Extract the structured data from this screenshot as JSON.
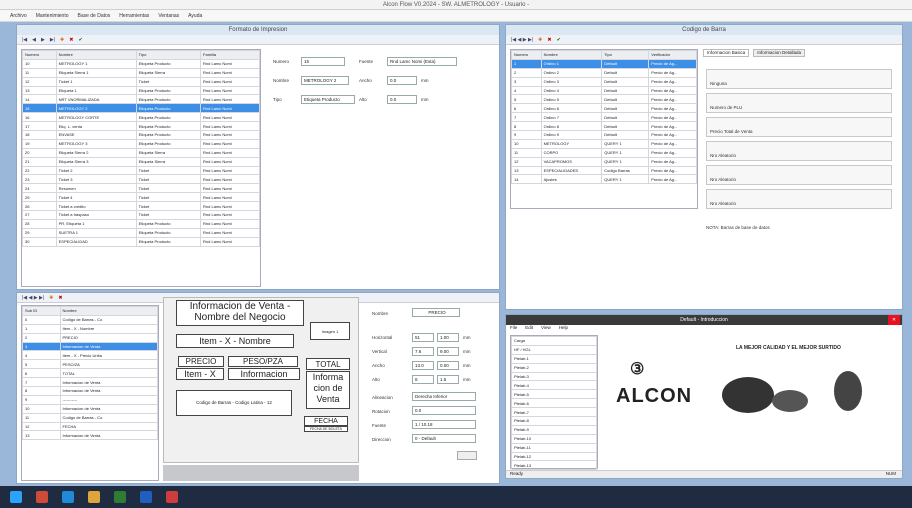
{
  "app": {
    "title": "Alcon Flow V0.2024 - SW. ALMETROLOGY - Usuario -",
    "menu": [
      "Archivo",
      "Mantenimiento",
      "Base de Datos",
      "Herramientas",
      "Ventanas",
      "Ayuda"
    ]
  },
  "formats_window": {
    "title": "Formato de Impresion",
    "grid_headers": [
      "Numero",
      "Nombre",
      "Tipo",
      "Familia"
    ],
    "rows": [
      [
        "10",
        "METROLOGY 1",
        "Etiqueta Producto",
        "Rnd Lamc Nomi"
      ],
      [
        "11",
        "Etiqueta Sierra 1",
        "Etiqueta Sierra",
        "Rnd Lamc Nomi"
      ],
      [
        "12",
        "Ticket 1",
        "Ticket",
        "Rnd Lamc Nomi"
      ],
      [
        "13",
        "Etiqueta 1",
        "Etiqueta Producto",
        "Rnd Lamc Nomi"
      ],
      [
        "14",
        "NRT VNORMALIZADA",
        "Etiqueta Producto",
        "Rnd Lamc Nomi"
      ],
      [
        "15",
        "METROLOGY 2",
        "Etiqueta Producto",
        "Rnd Lamc Nomi"
      ],
      [
        "16",
        "METROLOGY CORTE",
        "Etiqueta Producto",
        "Rnd Lamc Nomi"
      ],
      [
        "17",
        "Etiq. L. venta",
        "Etiqueta Producto",
        "Rnd Lamc Nomi"
      ],
      [
        "18",
        "ENVASE",
        "Etiqueta Producto",
        "Rnd Lamc Nomi"
      ],
      [
        "19",
        "METROLOGY 3",
        "Etiqueta Producto",
        "Rnd Lamc Nomi"
      ],
      [
        "20",
        "Etiqueta Sierra 2",
        "Etiqueta Sierra",
        "Rnd Lamc Nomi"
      ],
      [
        "21",
        "Etiqueta Sierra 3",
        "Etiqueta Sierra",
        "Rnd Lamc Nomi"
      ],
      [
        "22",
        "Ticket 2",
        "Ticket",
        "Rnd Lamc Nomi"
      ],
      [
        "23",
        "Ticket 3",
        "Ticket",
        "Rnd Lamc Nomi"
      ],
      [
        "24",
        "Resumen",
        "Ticket",
        "Rnd Lamc Nomi"
      ],
      [
        "25",
        "Ticket 4",
        "Ticket",
        "Rnd Lamc Nomi"
      ],
      [
        "26",
        "Ticket a credito",
        "Ticket",
        "Rnd Lamc Nomi"
      ],
      [
        "27",
        "Ticket a traspaso",
        "Ticket",
        "Rnd Lamc Nomi"
      ],
      [
        "28",
        "PR. Etiqueta 1",
        "Etiqueta Producto",
        "Rnd Lamc Nomi"
      ],
      [
        "29",
        "SUETRA 1",
        "Etiqueta Producto",
        "Rnd Lamc Nomi"
      ],
      [
        "30",
        "ESPECIALIDAD",
        "Etiqueta Producto",
        "Rnd Lamc Nomi"
      ]
    ],
    "selected_index": 5,
    "form": {
      "numero_label": "Numero",
      "numero": "15",
      "nombre_label": "Nombre",
      "nombre": "METROLOGY 2",
      "tipo_label": "Tipo",
      "tipo": "Etiqueta Producto",
      "fuente_label": "Fuente",
      "fuente": "Rnd Lamc Nomi (Esta)",
      "ancho_label": "Ancho",
      "ancho": "0.0",
      "alto_label": "Alto",
      "alto": "0.0",
      "mm": "mm"
    }
  },
  "sub_grid": {
    "headers": [
      "Sub ID",
      "Nombre"
    ],
    "rows": [
      [
        "0",
        "Codigo de Barras - Co"
      ],
      [
        "1",
        "Item - X - Nombre"
      ],
      [
        "2",
        "PRECIO"
      ],
      [
        "3",
        "Informacion de Venta"
      ],
      [
        "4",
        "Item - X - Precio Unita"
      ],
      [
        "5",
        "PESO/ZA"
      ],
      [
        "6",
        "TOTAL"
      ],
      [
        "7",
        "Informacion de Venta"
      ],
      [
        "8",
        "Informacion de Venta"
      ],
      [
        "9",
        "-----------"
      ],
      [
        "10",
        "Informacion de Venta"
      ],
      [
        "11",
        "Codigo de Barras - Co"
      ],
      [
        "12",
        "FECHA"
      ],
      [
        "13",
        "Informacion de Venta"
      ]
    ],
    "selected_index": 3
  },
  "ticket": {
    "info_venta": "Informacion de Venta -",
    "nombre_negocio": "Nombre del Negocio",
    "item_nombre": "Item - X - Nombre",
    "precio": "PRECIO",
    "peso": "PESO/PZA",
    "item": "Item - X",
    "informacion": "Informacion",
    "total": "TOTAL",
    "info_venta_vertical": "Informa cion de Venta",
    "barcode": "Codigo de Barras - Codigo Latina - 12",
    "fecha": "FECHA",
    "fecha_sub": "FECHA DE BOLETA",
    "imagen": "Imagen 1"
  },
  "properties": {
    "nombre_label": "Nombre",
    "nombre": "PRECIO",
    "rows": [
      [
        "Horizontal",
        "51",
        "1.00",
        "mm"
      ],
      [
        "Vertical",
        "7.6",
        "9.00",
        "mm"
      ],
      [
        "Ancho",
        "13.0",
        "0.00",
        "mm"
      ],
      [
        "Alto",
        "8",
        "1.5",
        "mm"
      ]
    ],
    "alineacion_label": "Alineacion",
    "alineacion": "Derecha Inferior",
    "rotacion_label": "Rotacion",
    "rotacion": "0.0",
    "fuente_label": "Fuente",
    "fuente": "1 / 10.18",
    "direccion_label": "Direccion",
    "direccion": "0 - Default"
  },
  "barcode_window": {
    "title": "Codigo de Barra",
    "headers": [
      "Numero",
      "Nombre",
      "Tipo",
      "Verificador"
    ],
    "rows": [
      [
        "1",
        "Ordino 1",
        "Default",
        "Precio de Ag..."
      ],
      [
        "2",
        "Ordino 2",
        "Default",
        "Precio de Ag..."
      ],
      [
        "3",
        "Ordino 3",
        "Default",
        "Precio de Ag..."
      ],
      [
        "4",
        "Ordino 4",
        "Default",
        "Precio de Ag..."
      ],
      [
        "5",
        "Ordino 5",
        "Default",
        "Precio de Ag..."
      ],
      [
        "6",
        "Ordino 6",
        "Default",
        "Precio de Ag..."
      ],
      [
        "7",
        "Ordino 7",
        "Default",
        "Precio de Ag..."
      ],
      [
        "8",
        "Ordino 8",
        "Default",
        "Precio de Ag..."
      ],
      [
        "9",
        "Ordino 9",
        "Default",
        "Precio de Ag..."
      ],
      [
        "10",
        "METROLOGY",
        "QUERY 1",
        "Precio de Ag..."
      ],
      [
        "11",
        "CORPO",
        "QUERY 1",
        "Precio de Ag..."
      ],
      [
        "12",
        "VACAPROMOS",
        "QUERY 1",
        "Precio de Ag..."
      ],
      [
        "13",
        "ESPECIALIDADES",
        "Codigo Barras",
        "Precio de Ag..."
      ],
      [
        "14",
        "Ajustes",
        "QUERY 1",
        "Precio de Ag..."
      ]
    ],
    "selected_index": 0,
    "tabs": [
      "Informacion Basica",
      "Informacion Detallada"
    ],
    "groups": [
      "Ninguna",
      "Numero de PLU",
      "Precio Total de Venta",
      "Nro Aleatorio",
      "Nro Aleatorio",
      "Nro Aleatorio"
    ],
    "footer": "NOTA: Barras de base de datos"
  },
  "intro_window": {
    "title": "Default - Introduccion",
    "menu": [
      "File",
      "Edit",
      "View",
      "Help"
    ],
    "list": [
      "Carga",
      "HF / HGL",
      "Ptelab-1",
      "Ptelab-2",
      "Ptelab-3",
      "Ptelab-4",
      "Ptelab-5",
      "Ptelab-6",
      "Ptelab-7",
      "Ptelab-8",
      "Ptelab-9",
      "Ptelab-10",
      "Ptelab-11",
      "Ptelab-12",
      "Ptelab-13"
    ],
    "logo": "ALCON",
    "slogan": "LA MEJOR CALIDAD Y EL MEJOR SURTIDO",
    "status": "Ready",
    "status_right": "NUM"
  },
  "colors": {
    "accent": "#3d8ee6",
    "taskbar": "#1e2b40",
    "close": "#e81123"
  }
}
